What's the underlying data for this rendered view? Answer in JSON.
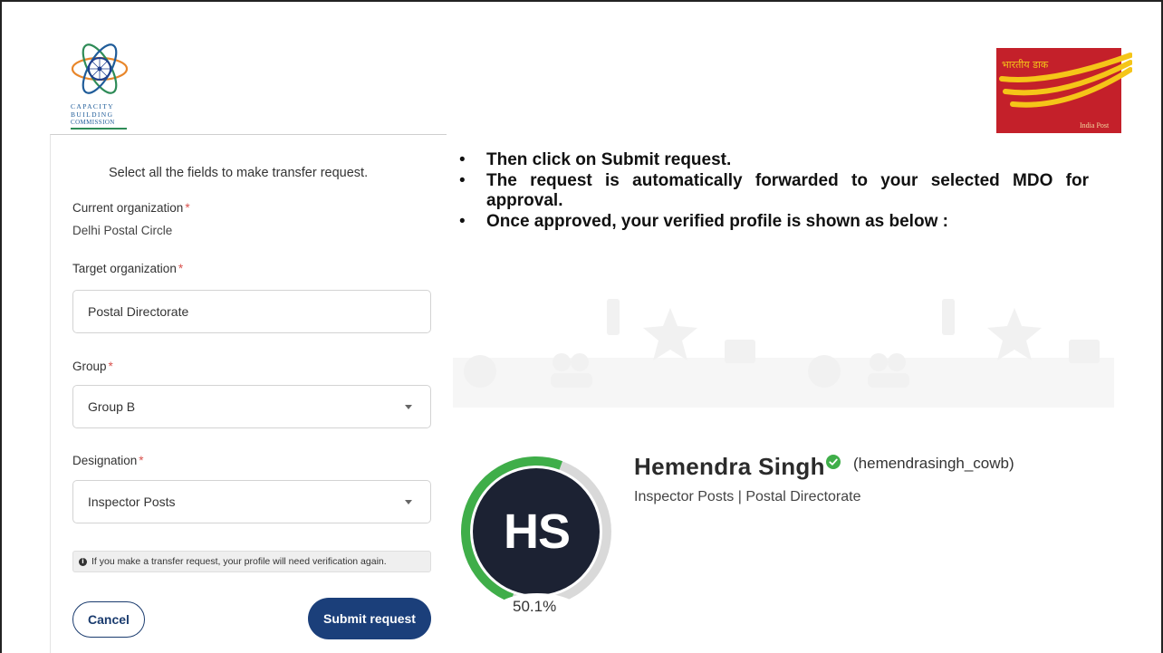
{
  "logos": {
    "left": {
      "icon": "capacity-building-commission-logo",
      "lines": [
        "CAPACITY",
        "BUILDING",
        "COMMISSION"
      ]
    },
    "right": {
      "icon": "india-post-logo",
      "hindi": "भारतीय डाक",
      "english": "India Post",
      "colors": {
        "background": "#c4202a",
        "stripes": "#f5c518"
      }
    }
  },
  "form": {
    "heading": "Select all the fields to make transfer request.",
    "current_org": {
      "label": "Current organization",
      "value": "Delhi Postal Circle"
    },
    "target_org": {
      "label": "Target organization",
      "value": "Postal Directorate"
    },
    "group": {
      "label": "Group",
      "value": "Group B"
    },
    "designation": {
      "label": "Designation",
      "value": "Inspector Posts"
    },
    "required_mark": "*",
    "notice": "If you make a transfer request, your profile will need verification again.",
    "cancel_label": "Cancel",
    "submit_label": "Submit request"
  },
  "instructions": [
    "Then click on Submit request.",
    "The request is automatically forwarded to your selected MDO for approval.",
    "Once approved, your verified profile is shown as below :"
  ],
  "profile": {
    "initials": "HS",
    "name": "Hemendra Singh",
    "handle": "(hemendrasingh_cowb)",
    "subtitle": "Inspector Posts | Postal Directorate",
    "progress_text": "50.1%",
    "progress_fraction": 0.501,
    "colors": {
      "avatar": "#1c2233",
      "progress": "#3fae49",
      "track": "#d9d9d9",
      "verified": "#3fae49"
    }
  },
  "colors": {
    "primary": "#1b3f7a",
    "required": "#d9534f"
  }
}
